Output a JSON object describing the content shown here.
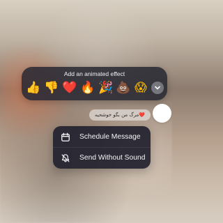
{
  "effect_picker": {
    "title": "Add an animated effect",
    "emojis": [
      {
        "name": "thumbs-up",
        "glyph": "👍"
      },
      {
        "name": "thumbs-down",
        "glyph": "👎"
      },
      {
        "name": "heart",
        "glyph": "❤️"
      },
      {
        "name": "fire",
        "glyph": "🔥"
      },
      {
        "name": "party-popper",
        "glyph": "🎉"
      },
      {
        "name": "poop",
        "glyph": "💩"
      },
      {
        "name": "face-with-hand",
        "glyph": "😱"
      }
    ],
    "expand_icon": "chevron-down-icon"
  },
  "message": {
    "text": "❤️مرگ من بگو خوشحیه",
    "avatar_color": "#ffffff"
  },
  "menu": {
    "items": [
      {
        "label": "Schedule Message",
        "icon": "calendar-icon"
      },
      {
        "label": "Send Without Sound",
        "icon": "bell-slash-icon"
      }
    ]
  },
  "colors": {
    "panel_background": "#28283a",
    "menu_background": "#22222e",
    "text_light": "#f4f5f8"
  }
}
